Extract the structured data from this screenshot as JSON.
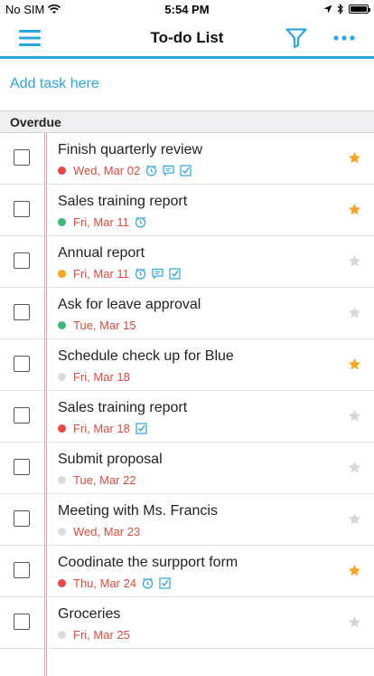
{
  "status_bar": {
    "carrier": "No SIM",
    "time": "5:54 PM"
  },
  "nav": {
    "title": "To-do List",
    "icons": [
      "menu-icon",
      "filter-icon",
      "more-icon"
    ]
  },
  "add_task": {
    "placeholder": "Add task here"
  },
  "section": {
    "title": "Overdue"
  },
  "colors": {
    "accent": "#2aa6e0",
    "overdue_date": "#e24a3b",
    "priority_high": "#e8474a",
    "priority_medium": "#f5a623",
    "priority_low": "#3cb67a",
    "priority_none": "#d9dbdf",
    "star_on": "#f5a623",
    "star_off": "#d6d6d8"
  },
  "tasks": [
    {
      "title": "Finish quarterly review",
      "date": "Wed, Mar 02",
      "priority": "high",
      "starred": true,
      "icons": [
        "reminder",
        "comment",
        "checklist"
      ]
    },
    {
      "title": "Sales training report",
      "date": "Fri, Mar 11",
      "priority": "low",
      "starred": true,
      "icons": [
        "reminder"
      ]
    },
    {
      "title": "Annual report",
      "date": "Fri, Mar 11",
      "priority": "medium",
      "starred": false,
      "icons": [
        "reminder",
        "comment",
        "checklist"
      ]
    },
    {
      "title": "Ask for leave approval",
      "date": "Tue, Mar 15",
      "priority": "low",
      "starred": false,
      "icons": []
    },
    {
      "title": "Schedule check up for Blue",
      "date": "Fri, Mar 18",
      "priority": "none",
      "starred": true,
      "icons": []
    },
    {
      "title": "Sales training report",
      "date": "Fri, Mar 18",
      "priority": "high",
      "starred": false,
      "icons": [
        "checklist"
      ]
    },
    {
      "title": "Submit proposal",
      "date": "Tue, Mar 22",
      "priority": "none",
      "starred": false,
      "icons": []
    },
    {
      "title": "Meeting with Ms. Francis",
      "date": "Wed, Mar 23",
      "priority": "none",
      "starred": false,
      "icons": []
    },
    {
      "title": "Coodinate the surpport form",
      "date": "Thu, Mar 24",
      "priority": "high",
      "starred": true,
      "icons": [
        "reminder",
        "checklist"
      ]
    },
    {
      "title": "Groceries",
      "date": "Fri, Mar 25",
      "priority": "none",
      "starred": false,
      "icons": []
    }
  ]
}
